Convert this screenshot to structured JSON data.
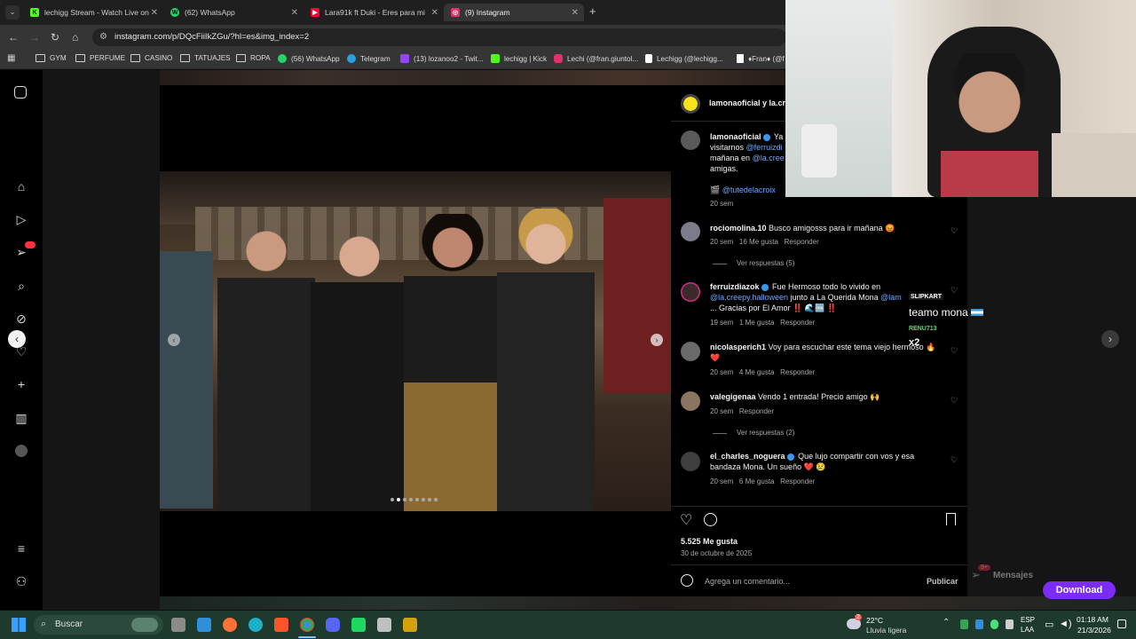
{
  "browser": {
    "tabs": [
      {
        "title": "lechigg Stream - Watch Live on",
        "favicon_color": "#53fc18",
        "favicon": "K"
      },
      {
        "title": "(62) WhatsApp",
        "favicon_color": "#25d366",
        "favicon": "W"
      },
      {
        "title": "Lara91k ft Duki - Eres para mi",
        "favicon_color": "#ff0033",
        "favicon": "▶"
      },
      {
        "title": "(9) Instagram",
        "favicon_color": "#e1306c",
        "favicon": "◎"
      }
    ],
    "url": "instagram.com/p/DQcFiiIkZGu/?hl=es&img_index=2",
    "bookmarks": [
      {
        "label": "GYM",
        "type": "folder"
      },
      {
        "label": "PERFUME",
        "type": "folder"
      },
      {
        "label": "CASINO",
        "type": "folder"
      },
      {
        "label": "TATUAJES",
        "type": "folder"
      },
      {
        "label": "ROPA",
        "type": "folder"
      },
      {
        "label": "(56) WhatsApp",
        "type": "site",
        "color": "#25d366"
      },
      {
        "label": "Telegram",
        "type": "site",
        "color": "#2aa1da"
      },
      {
        "label": "(13) lozanoo2 - Twit...",
        "type": "site",
        "color": "#9146ff"
      },
      {
        "label": "lechigg | Kick",
        "type": "site",
        "color": "#53fc18"
      },
      {
        "label": "Lechi (@fran.giuntol...",
        "type": "site",
        "color": "#e1306c"
      },
      {
        "label": "Lechigg (@lechigg...",
        "type": "site",
        "color": "#ffffff"
      },
      {
        "label": "♦Fran♦ (@f",
        "type": "site",
        "color": "#ffffff"
      }
    ]
  },
  "post": {
    "header": "lamonaoficial y la.cre",
    "caption": {
      "user": "lamonaoficial",
      "line1": "Ya",
      "line2_link": "@ferruizdi",
      "line2_pre": "visitarnos",
      "line3_pre": "mañana en",
      "line3_link": "@la.cree",
      "line4": "amigas.",
      "credit": "@tutedelacroix",
      "time": "20 sem"
    },
    "comments": [
      {
        "user": "rociomolina.10",
        "text": "Busco amigosss para ir mañana 😡",
        "time": "20 sem",
        "likes": "16 Me gusta",
        "reply": "Responder",
        "view_replies": "Ver respuestas (5)"
      },
      {
        "user": "ferruizdiazok",
        "text": "Fue Hermoso todo lo vivido en",
        "text2_link": "@la.creepy.halloween",
        "text2": "junto a La Querida Mona",
        "text2_link2": "@lam",
        "text3": "... Gracias por El Amor ‼️ 🌊🆒 ‼️",
        "time": "19 sem",
        "likes": "1 Me gusta",
        "reply": "Responder"
      },
      {
        "user": "nicolasperich1",
        "text": "Voy para escuchar este tema viejo hermoso 🔥",
        "text2": "❤️",
        "time": "20 sem",
        "likes": "4 Me gusta",
        "reply": "Responder"
      },
      {
        "user": "valegigenaa",
        "text": "Vendo 1 entrada! Precio amigo 🙌",
        "time": "20 sem",
        "reply": "Responder",
        "view_replies": "Ver respuestas (2)"
      },
      {
        "user": "el_charles_noguera",
        "text": "Que lujo compartir con vos y esa",
        "text2": "bandaza Mona. Un sueño ❤️ 😢",
        "time": "20 sem",
        "likes": "6 Me gusta",
        "reply": "Responder"
      }
    ],
    "likes_count": "5.525 Me gusta",
    "date": "30 de octubre de 2025",
    "comment_placeholder": "Agrega un comentario...",
    "publish": "Publicar"
  },
  "overlay_chat": {
    "badge1": "SLIPKART",
    "message": "teamo mona",
    "badge2": "RENU713",
    "multiplier": "x2"
  },
  "right_panel": {
    "messages_label": "Mensajes",
    "messages_badge": "9+"
  },
  "download_button": "Download",
  "taskbar": {
    "search_placeholder": "Buscar",
    "weather_temp": "22°C",
    "weather_desc": "Lluvia ligera",
    "weather_badge": "2",
    "lang": "ESP",
    "lang2": "LAA",
    "time": "01:18 AM",
    "date": "21/3/2026"
  }
}
